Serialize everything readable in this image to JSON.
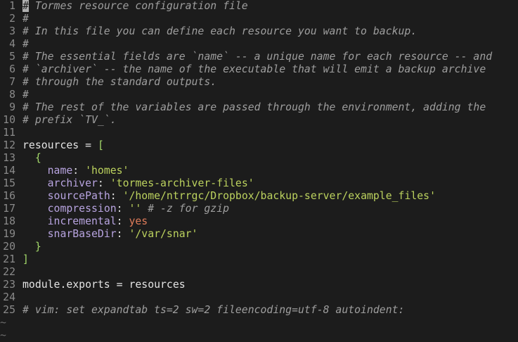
{
  "editor": {
    "file_lines": [
      {
        "num": "1",
        "segments": [
          {
            "cls": "cm cursor",
            "text": "#"
          },
          {
            "cls": "cm",
            "text": " Tormes resource configuration file"
          }
        ]
      },
      {
        "num": "2",
        "segments": [
          {
            "cls": "cm",
            "text": "#"
          }
        ]
      },
      {
        "num": "3",
        "segments": [
          {
            "cls": "cm",
            "text": "# In this file you can define each resource you want to backup."
          }
        ]
      },
      {
        "num": "4",
        "segments": [
          {
            "cls": "cm",
            "text": "#"
          }
        ]
      },
      {
        "num": "5",
        "segments": [
          {
            "cls": "cm",
            "text": "# The essential fields are `name` -- a unique name for each resource -- and"
          }
        ]
      },
      {
        "num": "6",
        "segments": [
          {
            "cls": "cm",
            "text": "# `archiver` -- the name of the executable that will emit a backup archive"
          }
        ]
      },
      {
        "num": "7",
        "segments": [
          {
            "cls": "cm",
            "text": "# through the standard outputs."
          }
        ]
      },
      {
        "num": "8",
        "segments": [
          {
            "cls": "cm",
            "text": "#"
          }
        ]
      },
      {
        "num": "9",
        "segments": [
          {
            "cls": "cm",
            "text": "# The rest of the variables are passed through the environment, adding the"
          }
        ]
      },
      {
        "num": "10",
        "segments": [
          {
            "cls": "cm",
            "text": "# prefix `TV_`."
          }
        ]
      },
      {
        "num": "11",
        "segments": []
      },
      {
        "num": "12",
        "segments": [
          {
            "cls": "plain",
            "text": "resources "
          },
          {
            "cls": "op",
            "text": "="
          },
          {
            "cls": "plain",
            "text": " "
          },
          {
            "cls": "brk",
            "text": "["
          }
        ]
      },
      {
        "num": "13",
        "segments": [
          {
            "cls": "plain",
            "text": "  "
          },
          {
            "cls": "brk",
            "text": "{"
          }
        ]
      },
      {
        "num": "14",
        "segments": [
          {
            "cls": "plain",
            "text": "    "
          },
          {
            "cls": "key",
            "text": "name"
          },
          {
            "cls": "plain",
            "text": ": "
          },
          {
            "cls": "str",
            "text": "'homes'"
          }
        ]
      },
      {
        "num": "15",
        "segments": [
          {
            "cls": "plain",
            "text": "    "
          },
          {
            "cls": "key",
            "text": "archiver"
          },
          {
            "cls": "plain",
            "text": ": "
          },
          {
            "cls": "str",
            "text": "'tormes-archiver-files'"
          }
        ]
      },
      {
        "num": "16",
        "segments": [
          {
            "cls": "plain",
            "text": "    "
          },
          {
            "cls": "key",
            "text": "sourcePath"
          },
          {
            "cls": "plain",
            "text": ": "
          },
          {
            "cls": "str",
            "text": "'/home/ntrrgc/Dropbox/backup-server/example_files'"
          }
        ]
      },
      {
        "num": "17",
        "segments": [
          {
            "cls": "plain",
            "text": "    "
          },
          {
            "cls": "key",
            "text": "compression"
          },
          {
            "cls": "plain",
            "text": ": "
          },
          {
            "cls": "str",
            "text": "''"
          },
          {
            "cls": "plain",
            "text": " "
          },
          {
            "cls": "cm",
            "text": "# -z for gzip"
          }
        ]
      },
      {
        "num": "18",
        "segments": [
          {
            "cls": "plain",
            "text": "    "
          },
          {
            "cls": "key",
            "text": "incremental"
          },
          {
            "cls": "plain",
            "text": ": "
          },
          {
            "cls": "kw",
            "text": "yes"
          }
        ]
      },
      {
        "num": "19",
        "segments": [
          {
            "cls": "plain",
            "text": "    "
          },
          {
            "cls": "key",
            "text": "snarBaseDir"
          },
          {
            "cls": "plain",
            "text": ": "
          },
          {
            "cls": "str",
            "text": "'/var/snar'"
          }
        ]
      },
      {
        "num": "20",
        "segments": [
          {
            "cls": "plain",
            "text": "  "
          },
          {
            "cls": "brk",
            "text": "}"
          }
        ]
      },
      {
        "num": "21",
        "segments": [
          {
            "cls": "brk",
            "text": "]"
          }
        ]
      },
      {
        "num": "22",
        "segments": []
      },
      {
        "num": "23",
        "segments": [
          {
            "cls": "plain",
            "text": "module.exports "
          },
          {
            "cls": "op",
            "text": "="
          },
          {
            "cls": "plain",
            "text": " resources"
          }
        ]
      },
      {
        "num": "24",
        "segments": []
      },
      {
        "num": "25",
        "segments": [
          {
            "cls": "cm",
            "text": "# vim: set expandtab ts=2 sw=2 fileencoding=utf-8 autoindent:"
          }
        ]
      }
    ],
    "empty_markers": [
      "~",
      "~"
    ]
  }
}
